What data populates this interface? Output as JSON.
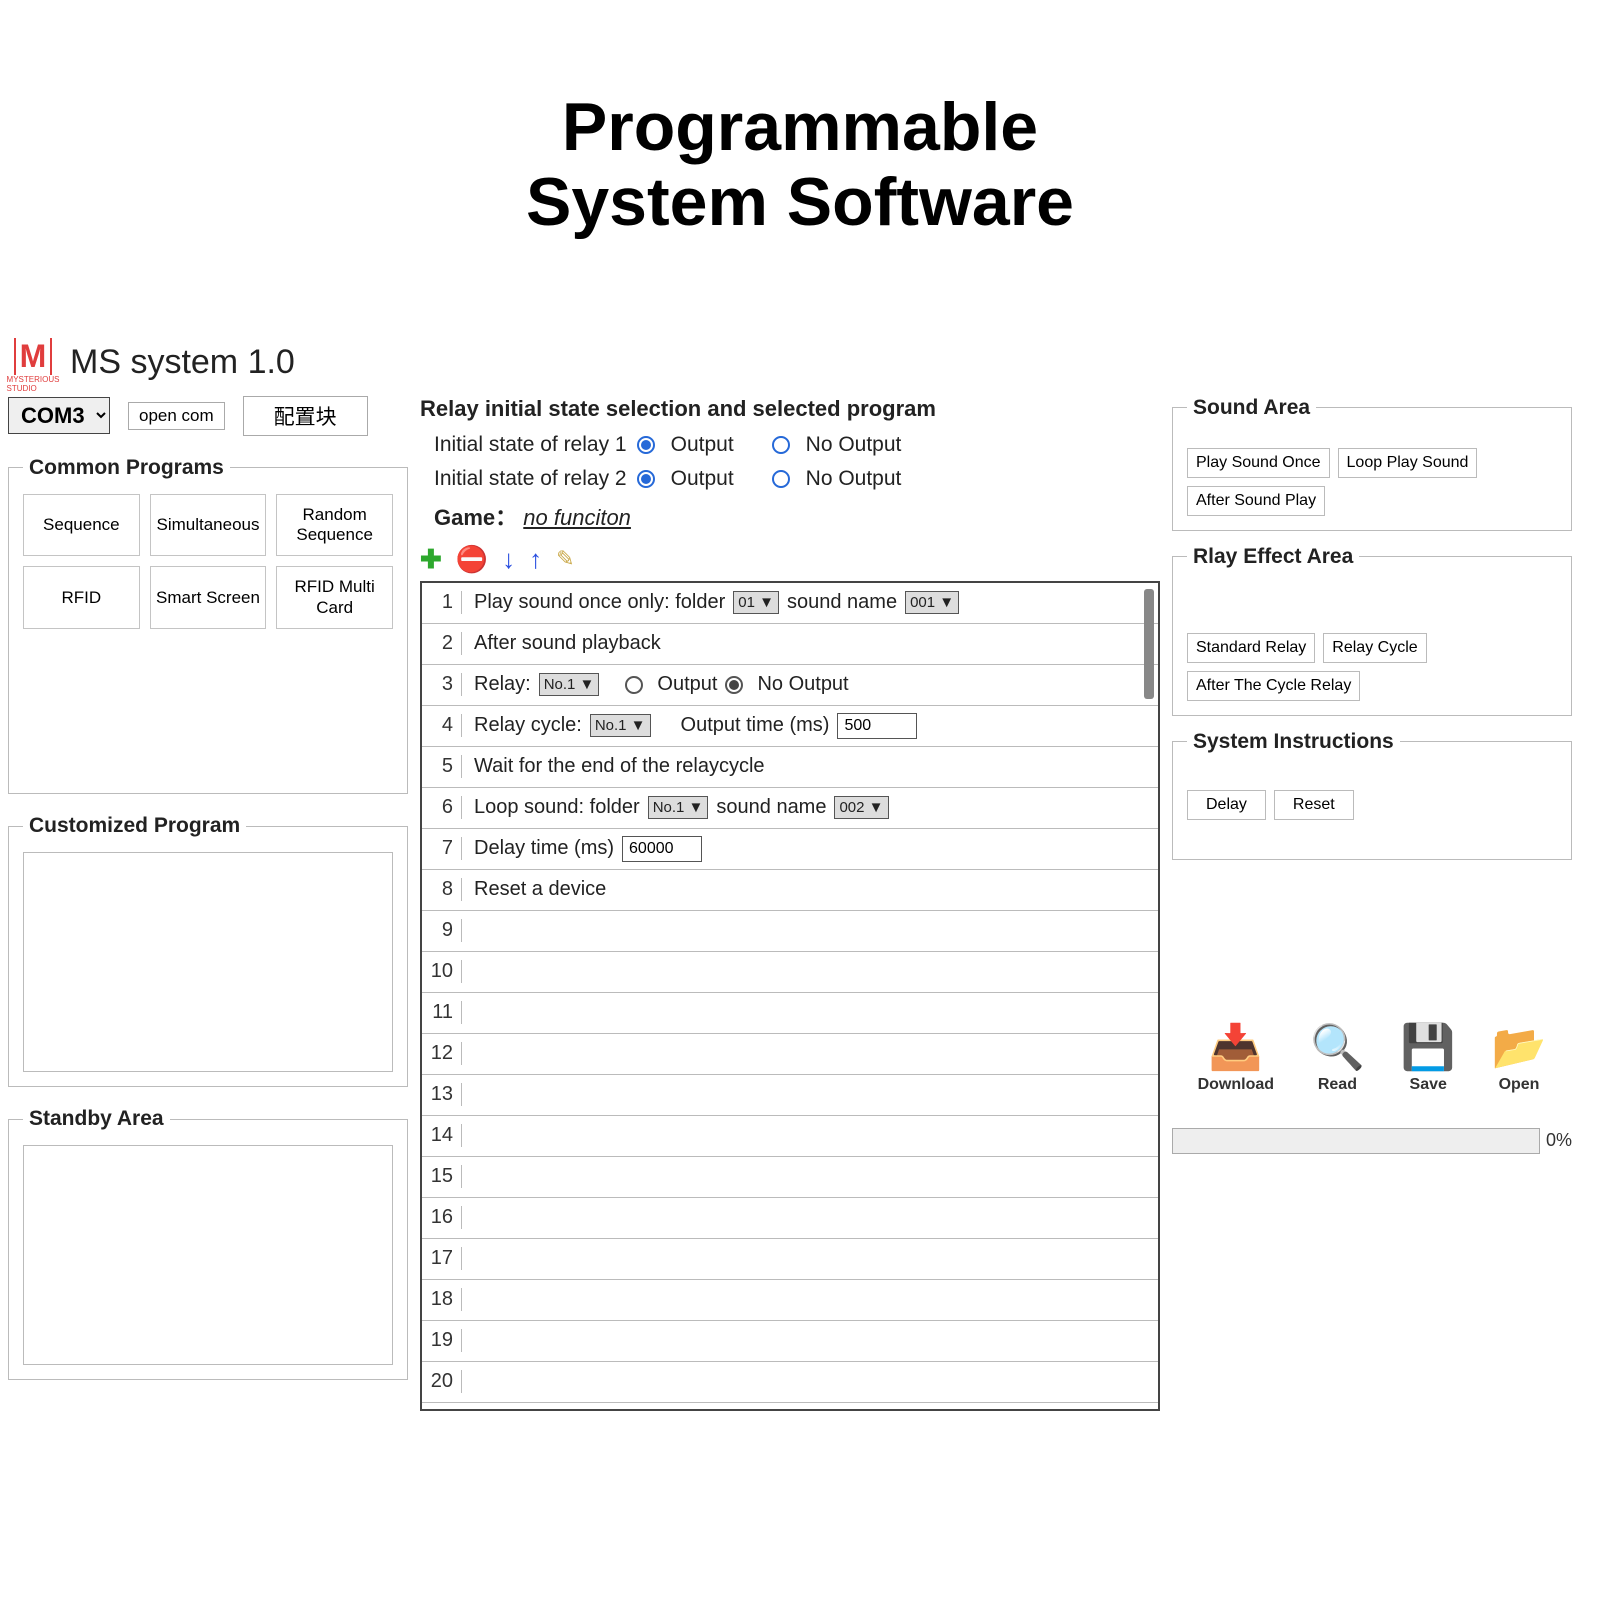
{
  "page_title_line1": "Programmable",
  "page_title_line2": "System Software",
  "logo_sub": "MYSTERIOUS STUDIO",
  "app_title": "MS system 1.0",
  "com_port": "COM3",
  "open_com": "open com",
  "config_btn": "配置块",
  "common_programs_legend": "Common Programs",
  "programs": [
    "Sequence",
    "Simultaneous",
    "Random Sequence",
    "RFID",
    "Smart Screen",
    "RFID Multi Card"
  ],
  "customized_legend": "Customized Program",
  "standby_legend": "Standby Area",
  "center_title": "Relay initial state selection and selected program",
  "relay1_label": "Initial state of relay 1",
  "relay2_label": "Initial state of relay 2",
  "output_label": "Output",
  "no_output_label": "No Output",
  "game_label": "Game：",
  "game_value": "no funciton",
  "rows": {
    "r1_a": "Play sound once only: folder",
    "r1_folder": "01 ▼",
    "r1_b": "sound name",
    "r1_sound": "001 ▼",
    "r2": "After sound playback",
    "r3_a": "Relay:",
    "r3_sel": "No.1 ▼",
    "r3_out": "Output",
    "r3_noout": "No Output",
    "r4_a": "Relay cycle:",
    "r4_sel": "No.1            ▼",
    "r4_b": "Output time (ms)",
    "r4_val": "500",
    "r5": "Wait for the end of the relaycycle",
    "r6_a": "Loop sound: folder",
    "r6_sel": "No.1 ▼",
    "r6_b": "sound name",
    "r6_sound": "002 ▼",
    "r7_a": "Delay time (ms)",
    "r7_val": "60000",
    "r8": "Reset a device"
  },
  "sound_legend": "Sound Area",
  "sound_buttons": [
    "Play Sound Once",
    "Loop Play Sound",
    "After Sound Play"
  ],
  "relay_legend": "Rlay Effect Area",
  "relay_buttons": [
    "Standard Relay",
    "Relay Cycle",
    "After The Cycle Relay"
  ],
  "sys_legend": "System Instructions",
  "sys_buttons": [
    "Delay",
    "Reset"
  ],
  "icons": {
    "download": "Download",
    "read": "Read",
    "save": "Save",
    "open": "Open"
  },
  "progress_pct": "0%"
}
